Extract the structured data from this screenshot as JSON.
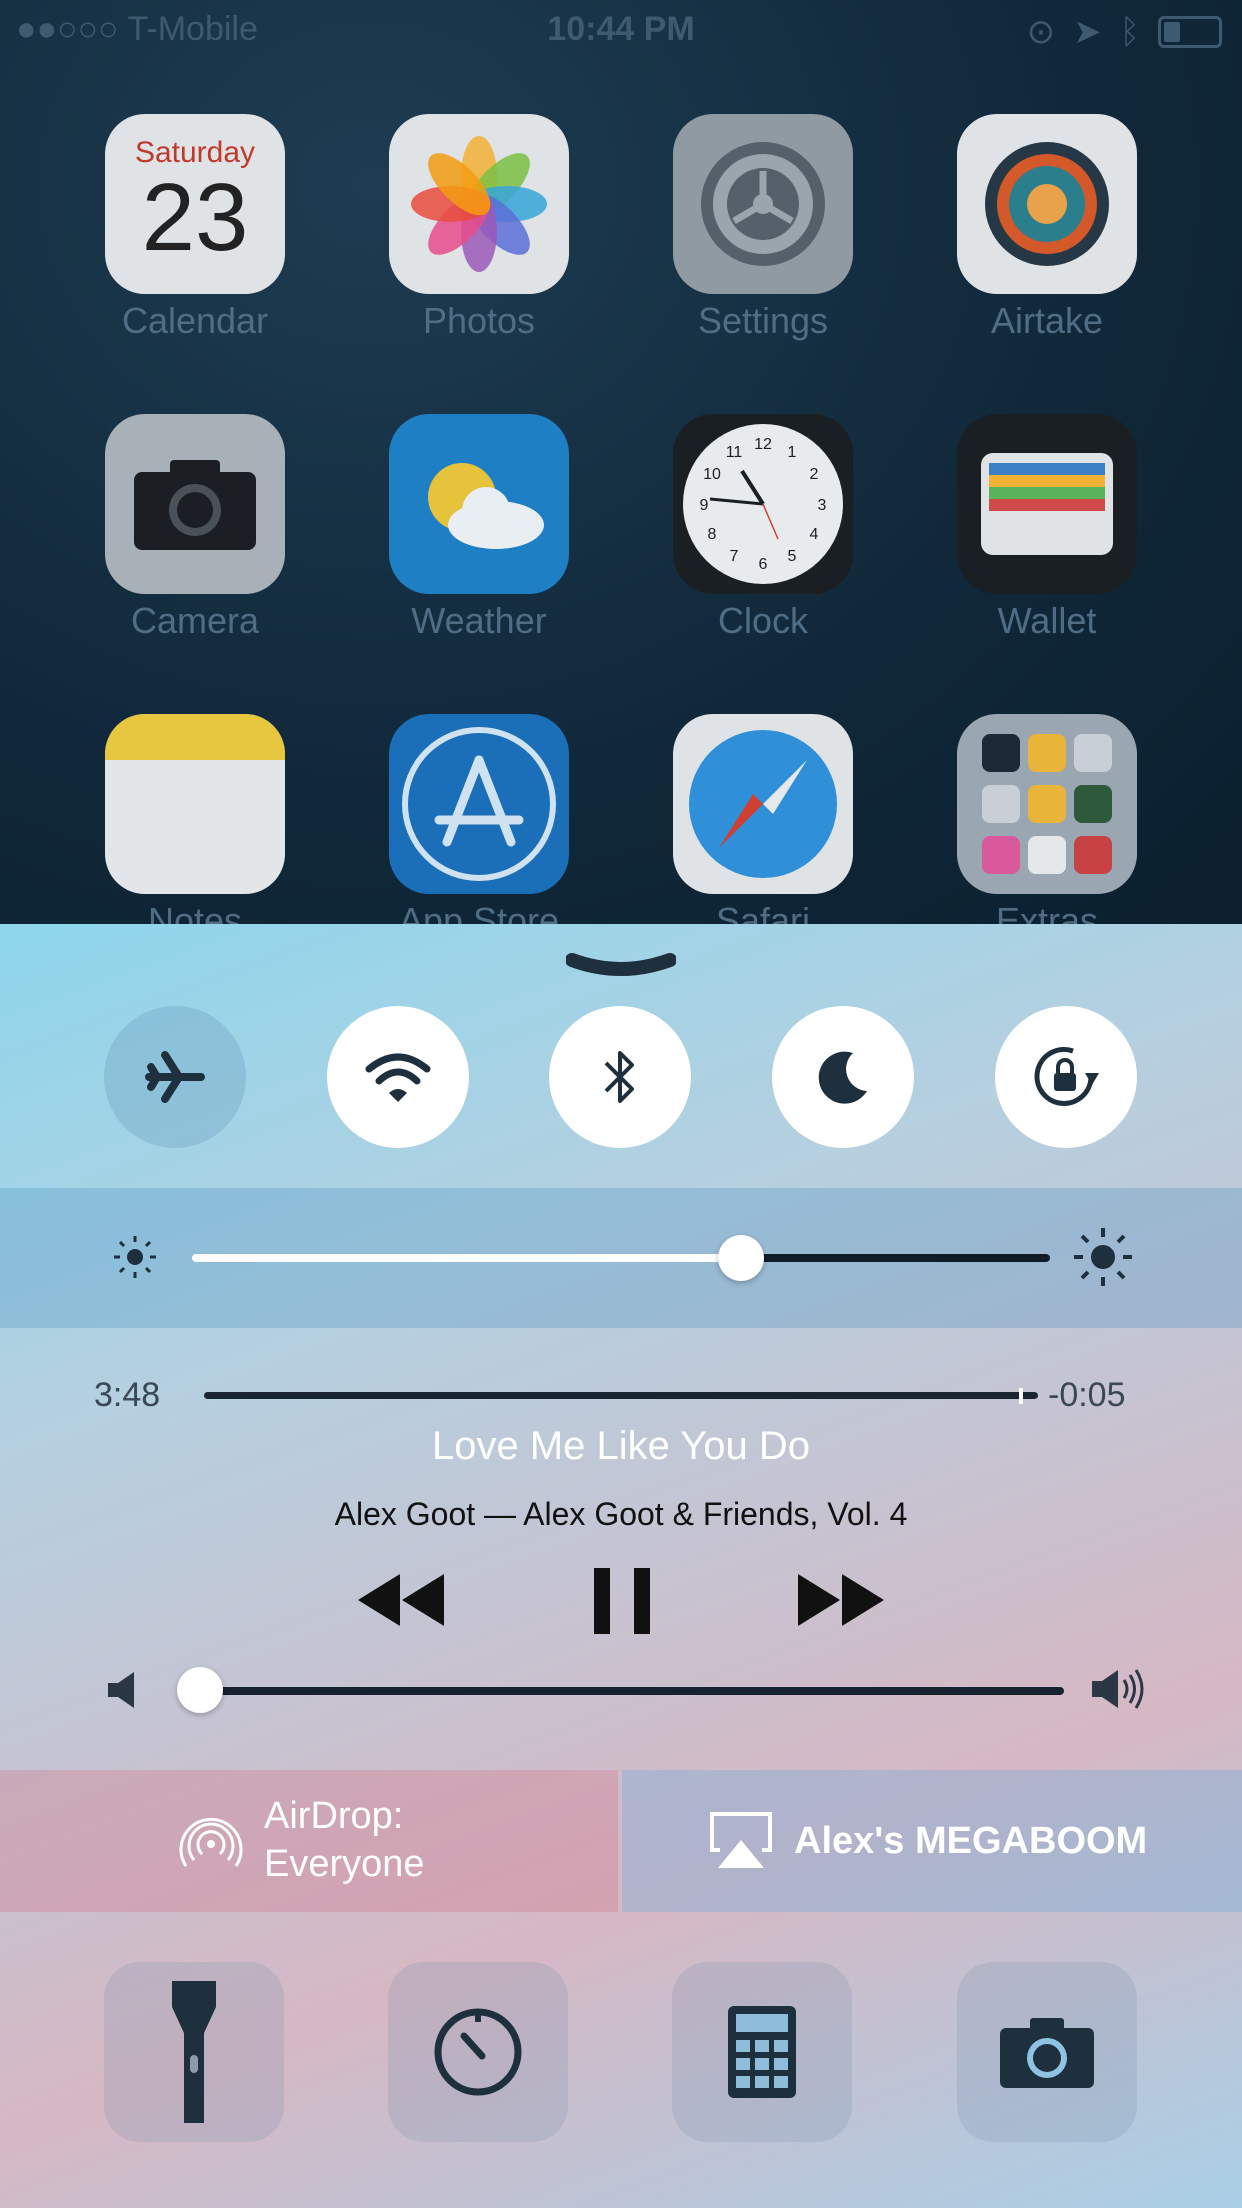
{
  "status_bar": {
    "carrier": "T-Mobile",
    "time": "10:44 PM"
  },
  "home": {
    "calendar_day": "Saturday",
    "calendar_date": "23",
    "apps": [
      {
        "label": "Calendar"
      },
      {
        "label": "Photos"
      },
      {
        "label": "Settings"
      },
      {
        "label": "Airtake"
      },
      {
        "label": "Camera"
      },
      {
        "label": "Weather"
      },
      {
        "label": "Clock"
      },
      {
        "label": "Wallet"
      },
      {
        "label": "Notes"
      },
      {
        "label": "App Store"
      },
      {
        "label": "Safari"
      },
      {
        "label": "Extras"
      }
    ]
  },
  "control_center": {
    "toggles": [
      {
        "name": "airplane-mode",
        "icon": "airplane-icon",
        "on": false
      },
      {
        "name": "wifi",
        "icon": "wifi-icon",
        "on": true
      },
      {
        "name": "bluetooth",
        "icon": "bluetooth-icon",
        "on": true
      },
      {
        "name": "do-not-disturb",
        "icon": "moon-icon",
        "on": true
      },
      {
        "name": "rotation-lock",
        "icon": "rotation-lock-icon",
        "on": true
      }
    ],
    "brightness_level": 0.64,
    "music": {
      "elapsed": "3:48",
      "remaining": "-0:05",
      "progress": 0.98,
      "title": "Love Me Like You Do",
      "artist_album": "Alex Goot — Alex Goot & Friends, Vol. 4",
      "volume_level": 0.0
    },
    "airdrop": {
      "line1": "AirDrop:",
      "line2": "Everyone"
    },
    "airplay": {
      "label": "Alex's MEGABOOM"
    },
    "shortcuts": [
      {
        "icon": "flashlight-icon"
      },
      {
        "icon": "timer-icon"
      },
      {
        "icon": "calculator-icon"
      },
      {
        "icon": "camera-icon"
      }
    ]
  }
}
